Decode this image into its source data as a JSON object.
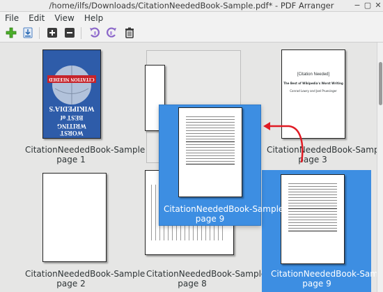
{
  "window": {
    "title": "/home/ilfs/Downloads/CitationNeededBook-Sample.pdf* - PDF Arranger",
    "controls": {
      "minimize": "−",
      "maximize": "▢",
      "close": "✕"
    }
  },
  "menu": {
    "file": "File",
    "edit": "Edit",
    "view": "View",
    "help": "Help"
  },
  "toolbar": {
    "icons": [
      "insert-pages-icon",
      "export-icon",
      "zoom-in-icon",
      "zoom-out-icon",
      "rotate-left-icon",
      "rotate-right-icon",
      "delete-icon"
    ]
  },
  "pages": [
    {
      "id": "p1",
      "name": "CitationNeededBook-Sample",
      "page": "page 1"
    },
    {
      "id": "p3",
      "name": "CitationNeededBook-Sample",
      "page": "page 3"
    },
    {
      "id": "p2",
      "name": "CitationNeededBook-Sample",
      "page": "page 2"
    },
    {
      "id": "p8",
      "name": "CitationNeededBook-Sample",
      "page": "page 8"
    },
    {
      "id": "p9",
      "name": "CitationNeededBook-Sample",
      "page": "page 9"
    }
  ],
  "dragging": {
    "name": "CitationNeededBook-Sample",
    "page": "page 9"
  },
  "cover": {
    "line1": "CITATION NEEDED",
    "line2": "WIKIPEDIA'S",
    "line3": "BEST of",
    "line4": "WORST WRITING"
  },
  "page3_text": {
    "title": "[Citation Needed]",
    "subtitle": "The Best of Wikipedia's Worst Writing",
    "authors": "Conrad Lowry and Joel Pruesinger"
  },
  "colors": {
    "selection": "#3d8ee2",
    "arrow": "#e01b24",
    "cover_bg": "#2d5aa8"
  }
}
